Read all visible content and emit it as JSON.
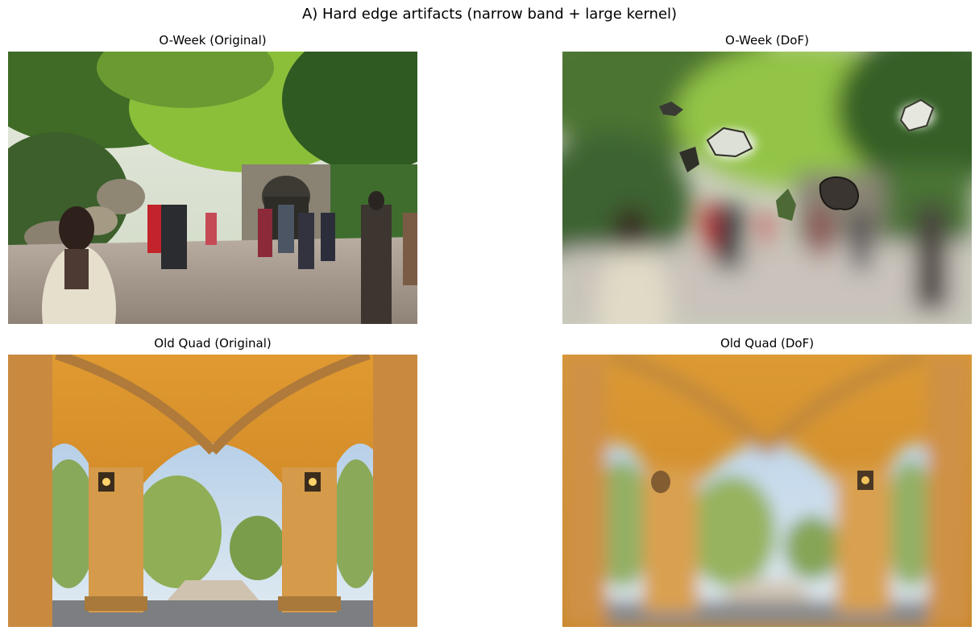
{
  "figure": {
    "title": "A) Hard edge artifacts (narrow band + large kernel)"
  },
  "panels": [
    {
      "title": "O-Week (Original)"
    },
    {
      "title": "O-Week (DoF)"
    },
    {
      "title": "Old Quad (Original)"
    },
    {
      "title": "Old Quad (DoF)"
    }
  ]
}
